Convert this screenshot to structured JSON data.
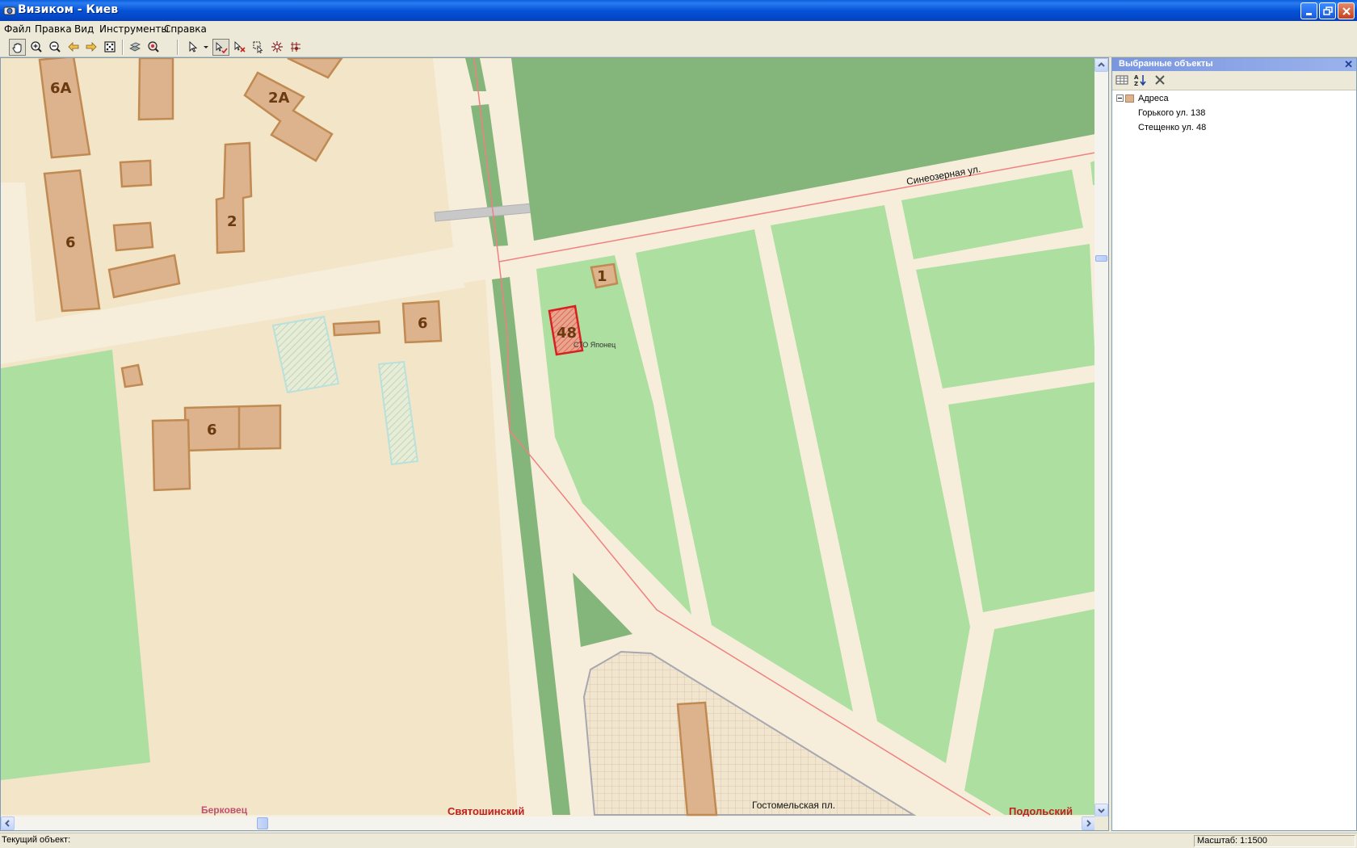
{
  "window": {
    "title": "Визиком - Киев"
  },
  "menu": {
    "items": [
      "Файл",
      "Правка",
      "Вид",
      "Инструменты",
      "Справка"
    ]
  },
  "toolbar": {
    "icons": [
      "pan-hand-icon",
      "zoom-in-icon",
      "zoom-out-icon",
      "back-arrow-icon",
      "forward-arrow-icon",
      "zoom-extent-icon",
      "layers-icon",
      "search-location-icon",
      "select-arrow-icon",
      "select-dropdown-icon",
      "select-objects-icon",
      "deselect-icon",
      "select-by-area-icon",
      "measure-icon",
      "grid-snap-icon"
    ]
  },
  "map": {
    "building_labels": {
      "b6a": "6А",
      "b2a": "2А",
      "b2": "2",
      "b6_left": "6",
      "b6_mid": "6",
      "b6_bottom": "6",
      "b1": "1",
      "b48": "48"
    },
    "poi_label": "СТО Японец",
    "street_label": "Синеозерная ул.",
    "square_label": "Гостомельская пл.",
    "district_labels": {
      "left": "Берковец",
      "center": "Святошинский",
      "right": "Подольский"
    },
    "colors": {
      "residential": "#f3e5c7",
      "road": "#f6eedb",
      "green": "#acdfa0",
      "dark_green": "#84b57a",
      "building": "#dcb38c",
      "building_border": "#c08a52",
      "selected": "#e04040",
      "boundary": "#f08080"
    }
  },
  "panel": {
    "title": "Выбранные объекты",
    "tree": {
      "group": "Адреса",
      "items": [
        "Горького ул. 138",
        "Стещенко ул. 48"
      ]
    }
  },
  "status": {
    "current_object": "Текущий объект:",
    "scale": "Масштаб: 1:1500"
  }
}
